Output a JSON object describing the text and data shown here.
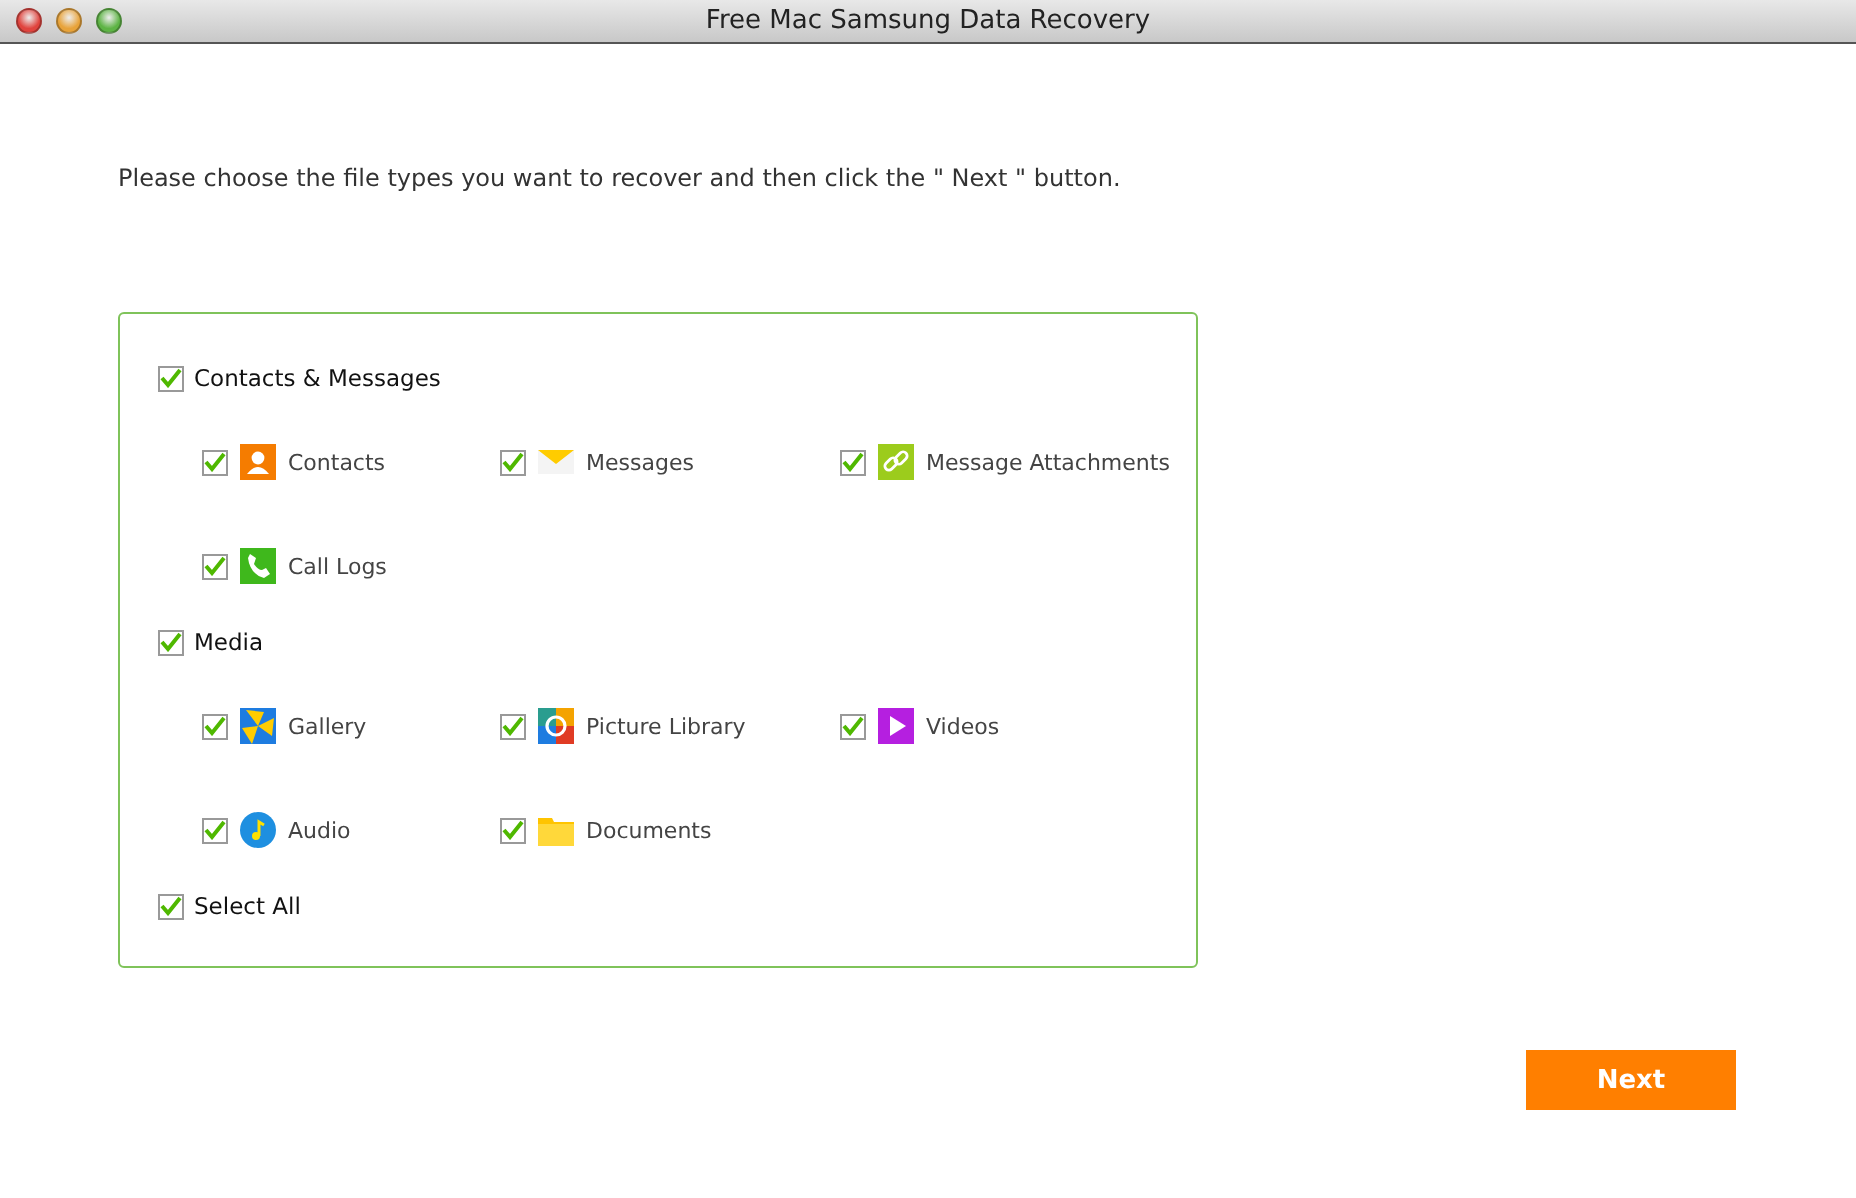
{
  "window": {
    "title": "Free Mac Samsung Data Recovery"
  },
  "instruction": "Please choose the file types you want to recover and then click the \" Next \" button.",
  "groups": [
    {
      "label": "Contacts & Messages",
      "checked": true,
      "items": [
        {
          "label": "Contacts",
          "kind": "contacts",
          "checked": true
        },
        {
          "label": "Messages",
          "kind": "messages",
          "checked": true
        },
        {
          "label": "Message Attachments",
          "kind": "attachments",
          "checked": true
        },
        {
          "label": "Call Logs",
          "kind": "calllogs",
          "checked": true
        }
      ]
    },
    {
      "label": "Media",
      "checked": true,
      "items": [
        {
          "label": "Gallery",
          "kind": "gallery",
          "checked": true
        },
        {
          "label": "Picture Library",
          "kind": "picturelibrary",
          "checked": true
        },
        {
          "label": "Videos",
          "kind": "videos",
          "checked": true
        },
        {
          "label": "Audio",
          "kind": "audio",
          "checked": true
        },
        {
          "label": "Documents",
          "kind": "documents",
          "checked": true
        }
      ]
    }
  ],
  "select_all": {
    "label": "Select All",
    "checked": true
  },
  "next_button": "Next"
}
